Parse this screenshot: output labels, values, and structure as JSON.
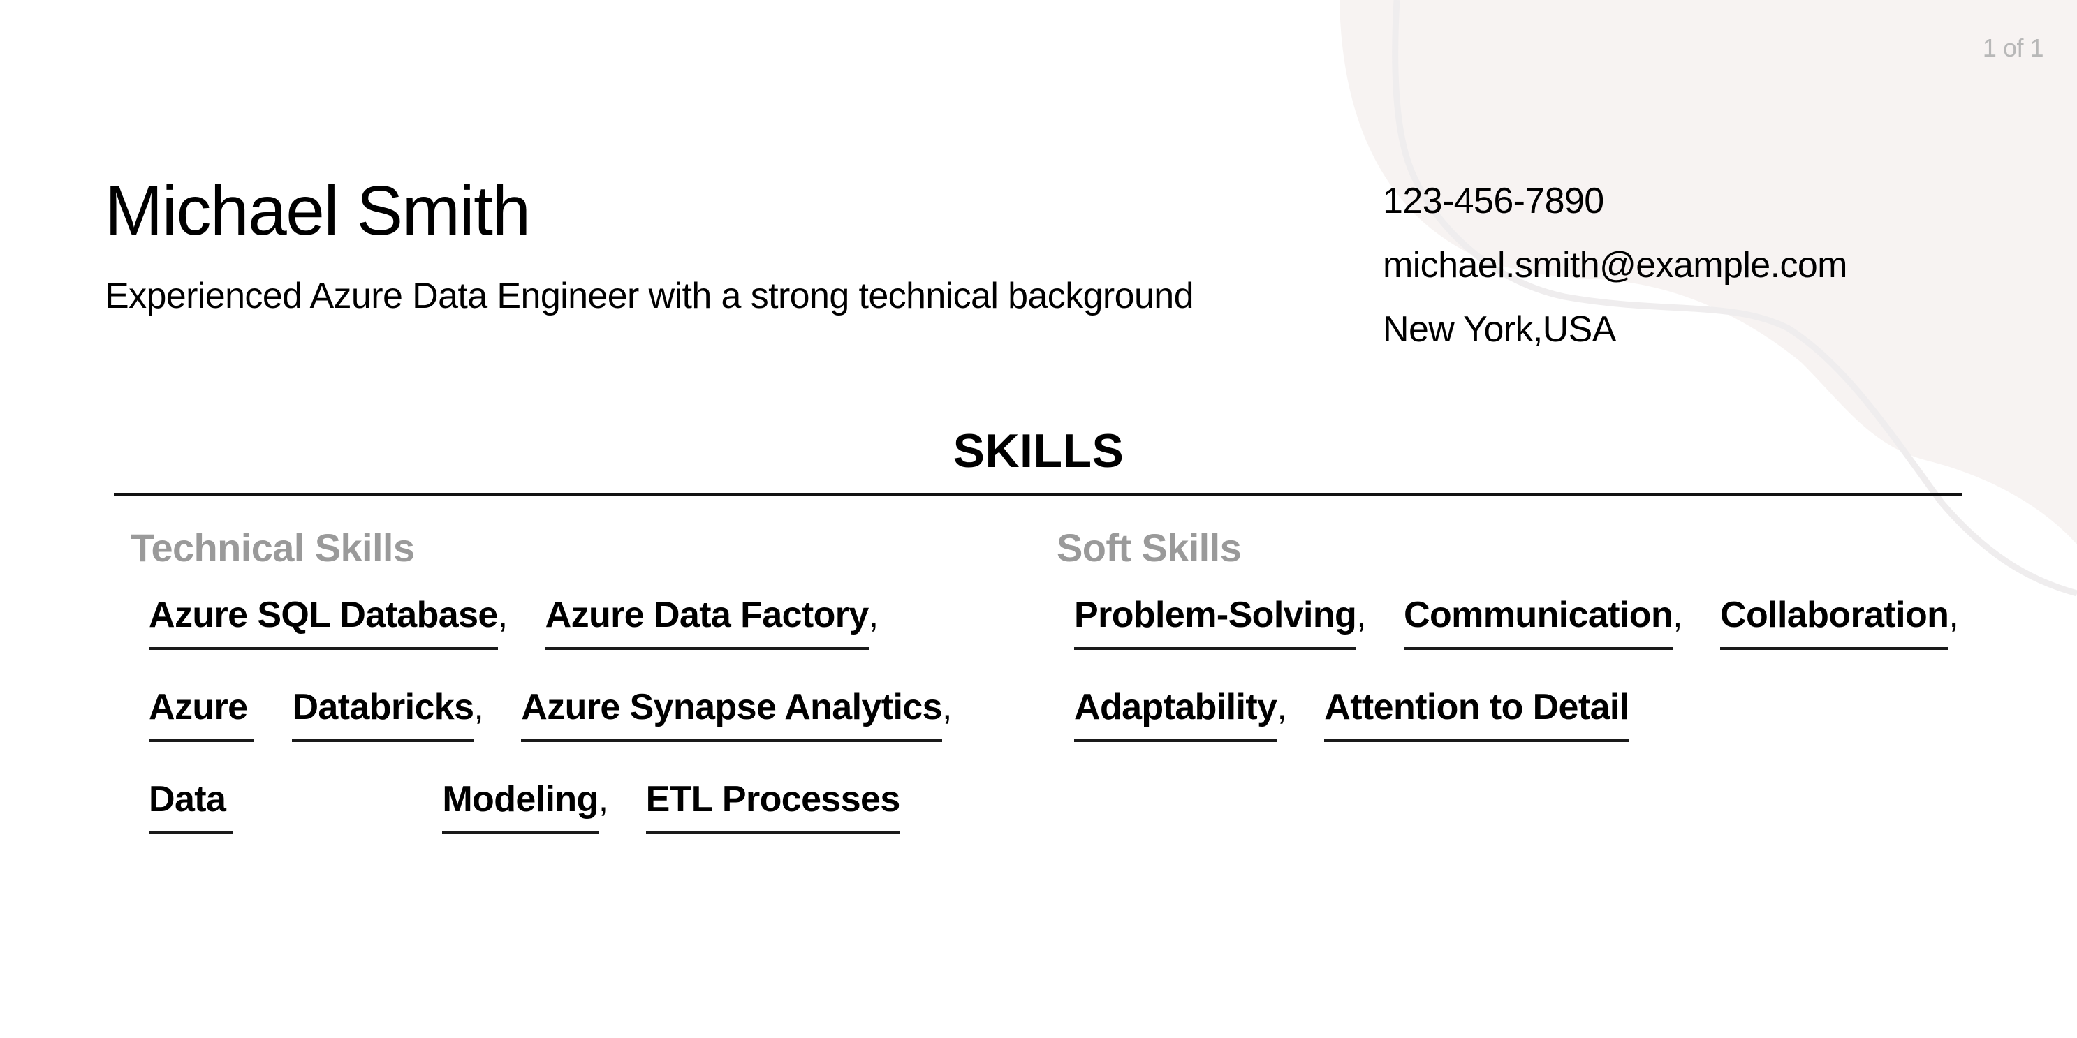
{
  "page": {
    "counter": "1 of 1"
  },
  "header": {
    "name": "Michael Smith",
    "tagline": "Experienced Azure Data Engineer with a strong technical background"
  },
  "contact": {
    "phone": "123-456-7890",
    "email": "michael.smith@example.com",
    "location": "New York,USA"
  },
  "skills_section": {
    "title": "SKILLS",
    "technical": {
      "heading": "Technical Skills",
      "items": [
        {
          "label": "Azure SQL Database",
          "sep": ","
        },
        {
          "label": "Azure Data Factory",
          "sep": ","
        },
        {
          "label": "Azure",
          "sep": ""
        },
        {
          "label": "Databricks",
          "sep": ","
        },
        {
          "label": "Azure Synapse Analytics",
          "sep": ","
        },
        {
          "label": "Data",
          "sep": ""
        },
        {
          "label": "Modeling",
          "sep": ","
        },
        {
          "label": "ETL Processes",
          "sep": ""
        }
      ]
    },
    "soft": {
      "heading": "Soft Skills",
      "items": [
        {
          "label": "Problem-Solving",
          "sep": ","
        },
        {
          "label": "Communication",
          "sep": ","
        },
        {
          "label": "Collaboration",
          "sep": ","
        },
        {
          "label": "Adaptability",
          "sep": ","
        },
        {
          "label": "Attention to Detail",
          "sep": ""
        }
      ]
    }
  },
  "colors": {
    "background": "#ffffff",
    "blob": "#f7f3f2",
    "blob_stroke": "#efedee",
    "heading_gray": "#9a9a9a",
    "counter_gray": "#b8b8b8",
    "text": "#000000"
  }
}
